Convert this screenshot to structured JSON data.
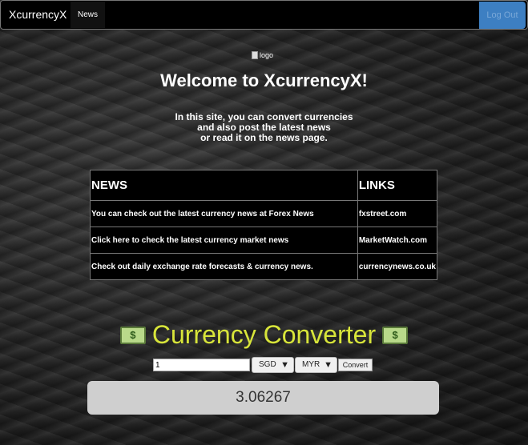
{
  "navbar": {
    "brand": "XcurrencyX",
    "news_label": "News",
    "logout_label": "Log Out"
  },
  "hero": {
    "logo_alt": "logo",
    "title": "Welcome to XcurrencyX!",
    "intro_lines": [
      "In this site, you can convert currencies",
      "and also post the latest news",
      "or read it on the news page."
    ]
  },
  "news_table": {
    "headers": [
      "NEWS",
      "LINKS"
    ],
    "rows": [
      {
        "news": "You can check out the latest currency news at Forex News",
        "link": "fxstreet.com"
      },
      {
        "news": "Click here to check the latest currency market news",
        "link": "MarketWatch.com"
      },
      {
        "news": "Check out daily exchange rate forecasts & currency news.",
        "link": "currencynews.co.uk"
      }
    ]
  },
  "converter": {
    "title": "Currency Converter",
    "amount_value": "1",
    "from_currency": "SGD",
    "to_currency": "MYR",
    "convert_label": "Convert",
    "result": "3.06267"
  },
  "colors": {
    "navbar_bg": "#000000",
    "logout_bg": "#3d7fc2",
    "converter_title": "#d8e53a",
    "result_bg": "#cfcfcf"
  },
  "icons": [
    "money-icon",
    "dropdown-arrow-icon",
    "broken-image-icon"
  ]
}
